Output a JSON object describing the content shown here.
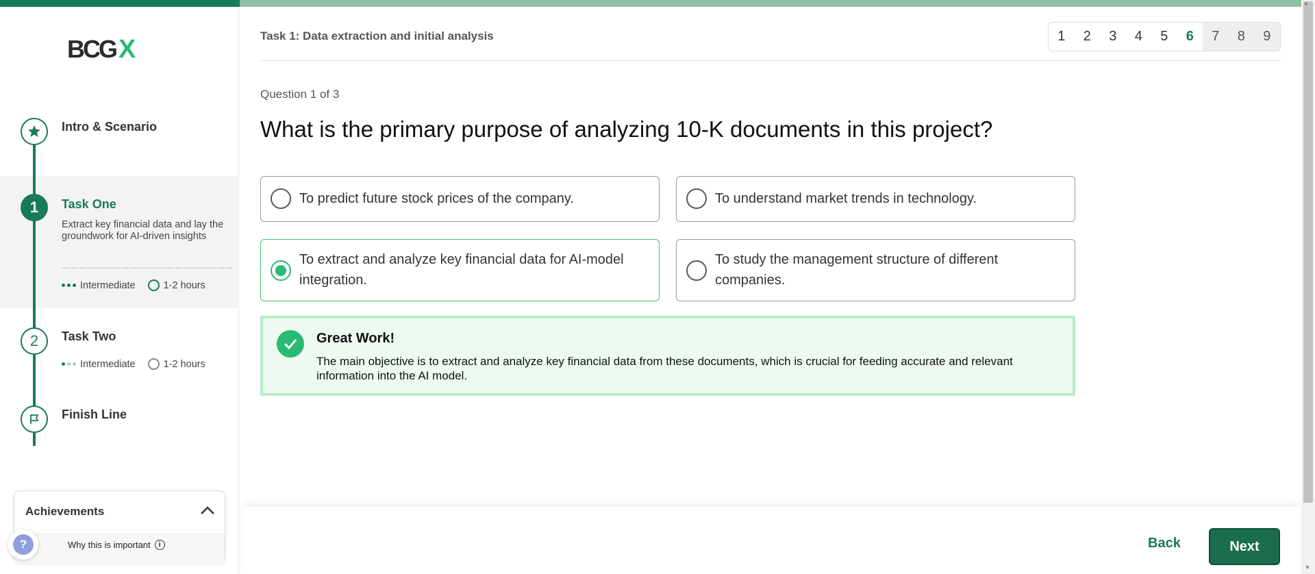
{
  "brand": {
    "logo_text": "BCG",
    "logo_x": "X",
    "accent": "#197a56",
    "accent_light": "#29ba74"
  },
  "sidebar": {
    "steps": [
      {
        "title": "Intro & Scenario",
        "icon": "star-icon"
      },
      {
        "number": "1",
        "title": "Task One",
        "description": "Extract key financial data and lay the groundwork for AI-driven insights",
        "level": "Intermediate",
        "duration": "1-2 hours",
        "active": true
      },
      {
        "number": "2",
        "title": "Task Two",
        "level": "Intermediate",
        "duration": "1-2 hours"
      },
      {
        "title": "Finish Line",
        "icon": "flag-icon"
      }
    ],
    "achievements": {
      "title": "Achievements",
      "why_label": "Why this is important",
      "help_label": "?"
    }
  },
  "main": {
    "task_header": "Task 1: Data extraction and initial analysis",
    "pager": [
      "1",
      "2",
      "3",
      "4",
      "5",
      "6",
      "7",
      "8",
      "9"
    ],
    "pager_current": "6",
    "question_count": "Question 1 of 3",
    "question": "What is the primary purpose of analyzing 10-K documents in this project?",
    "options": [
      "To predict future stock prices of the company.",
      "To understand market trends in technology.",
      "To extract and analyze key financial data for AI-model integration.",
      "To study the management structure of different companies."
    ],
    "selected_option": 3,
    "feedback": {
      "title": "Great Work!",
      "body": "The main objective is to extract and analyze key financial data from these documents, which is crucial for feeding accurate and relevant information into the AI model."
    }
  },
  "footer": {
    "back_label": "Back",
    "next_label": "Next"
  }
}
